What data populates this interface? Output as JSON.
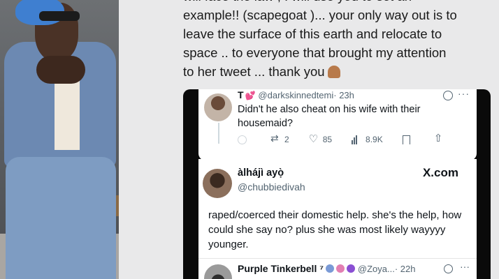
{
  "caption": {
    "line1": "will face the law , I will use you to set an",
    "line2": "example!! (scapegoat )... your only way out is to",
    "line3": "leave the surface of this earth and relocate to",
    "line4": "space .. to everyone that brought my attention",
    "line5": "to her tweet ... thank you"
  },
  "tweet1": {
    "name": "T",
    "handle": "@darkskinnedtemi",
    "time": "· 23h",
    "text": "Didn't he also cheat on his wife with their housemaid?",
    "retweets": "2",
    "likes": "85",
    "views": "8.9K",
    "more": "···"
  },
  "tweet2": {
    "name": "àlhájì ayọ̀",
    "handle": "@chubbiedivah",
    "watermark": "X.com",
    "text": "raped/coerced their domestic help. she's the help, how could she say no? plus she was most likely wayyyy younger."
  },
  "tweet3": {
    "name": "Purple Tinkerbell ⁷",
    "handle": "@Zoya...",
    "time": "· 22h",
    "more": "···"
  }
}
